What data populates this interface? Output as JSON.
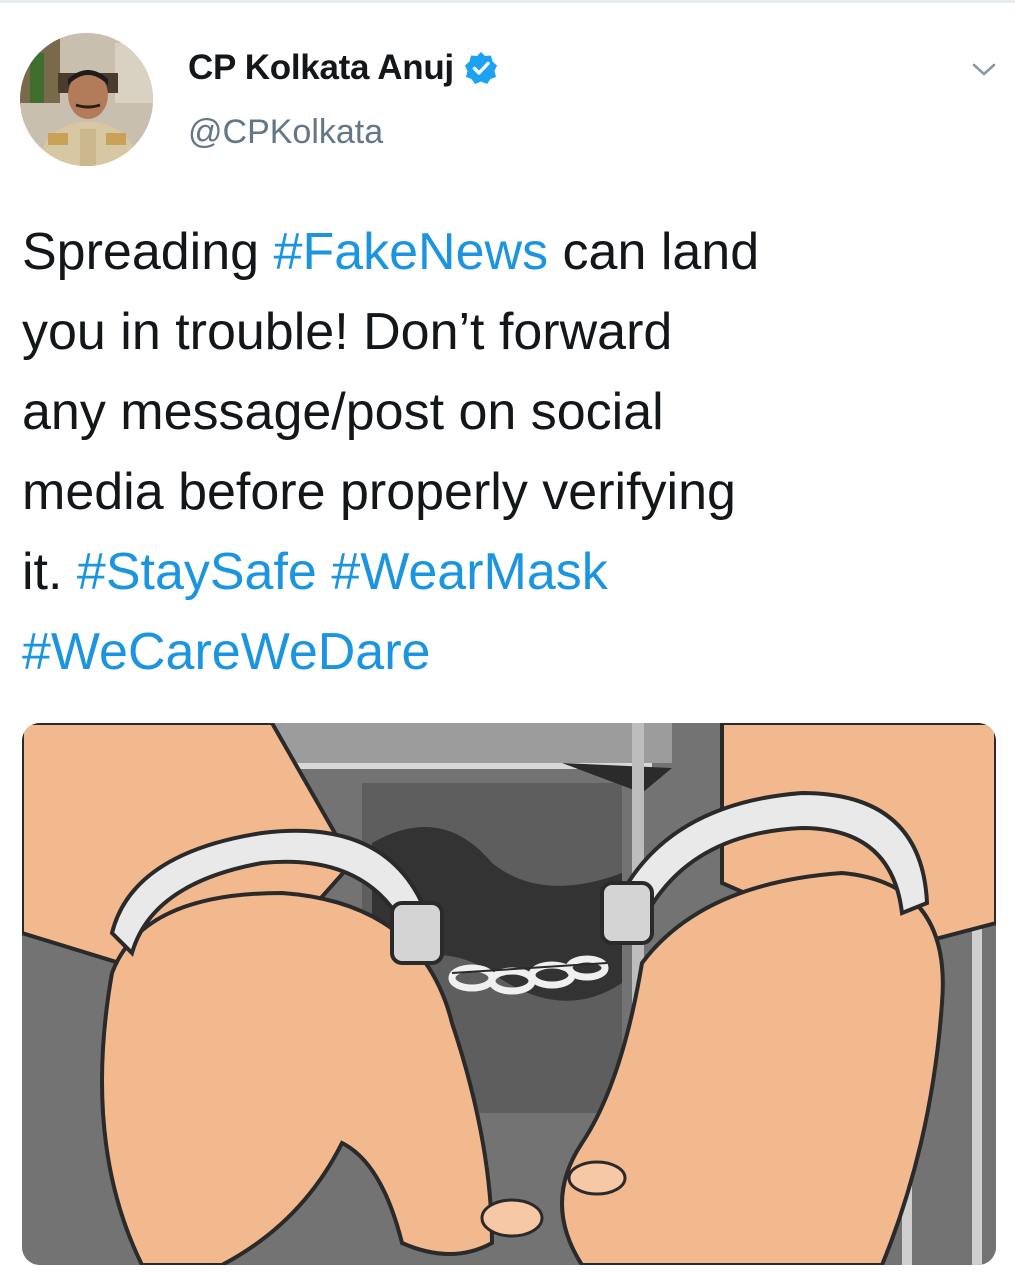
{
  "author": {
    "display_name": "CP Kolkata Anuj",
    "handle": "@CPKolkata",
    "verified": true,
    "avatar_icon": "officer-portrait-avatar"
  },
  "tweet": {
    "lines": [
      [
        {
          "t": "Spreading ",
          "tag": false
        },
        {
          "t": "#FakeNews",
          "tag": true
        },
        {
          "t": " can land",
          "tag": false
        }
      ],
      [
        {
          "t": "you in trouble! Don’t forward",
          "tag": false
        }
      ],
      [
        {
          "t": "any message/post on social",
          "tag": false
        }
      ],
      [
        {
          "t": "media before properly verifying",
          "tag": false
        }
      ],
      [
        {
          "t": "it. ",
          "tag": false
        },
        {
          "t": "#StaySafe",
          "tag": true
        },
        {
          "t": " ",
          "tag": false
        },
        {
          "t": "#WearMask",
          "tag": true
        }
      ],
      [
        {
          "t": "#WeCareWeDare",
          "tag": true
        }
      ]
    ]
  },
  "media": {
    "description_icon": "handcuffed-hands-illustration"
  },
  "menu": {
    "caret_icon": "chevron-down-icon"
  },
  "colors": {
    "hashtag": "#1b95e0",
    "verified_badge": "#1da1f2",
    "handle": "#657786",
    "skin": "#f2b98f",
    "background_gray": "#6f6f6f"
  }
}
